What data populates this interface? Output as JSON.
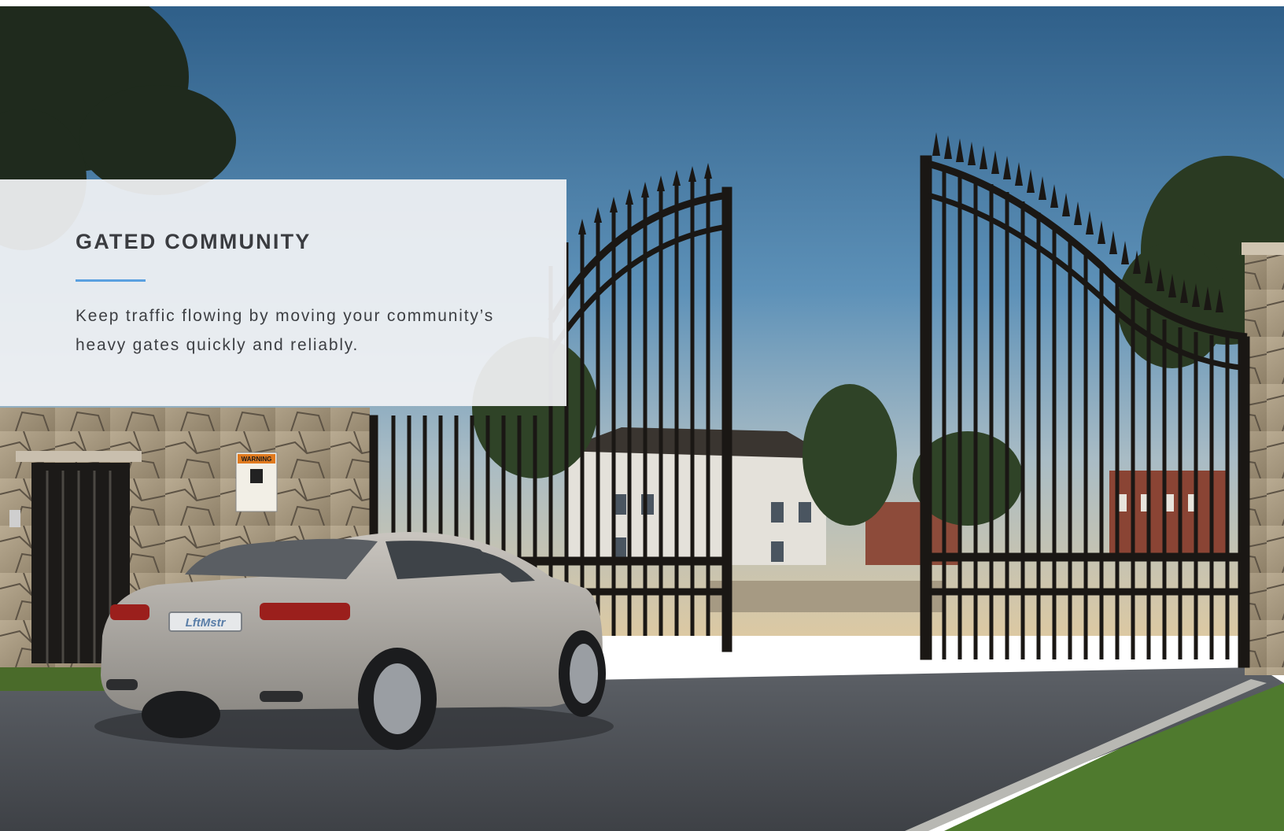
{
  "section": {
    "title": "GATED COMMUNITY",
    "description": "Keep traffic flowing by moving your community’s heavy gates quickly and reliably."
  },
  "scene": {
    "plate_text": "LftMstr",
    "sign_heading": "WARNING"
  },
  "colors": {
    "accent_rule": "#5aa0e0",
    "title_text": "#3a3c40",
    "body_text": "#3d3f43",
    "card_background": "#f1f2f4"
  }
}
